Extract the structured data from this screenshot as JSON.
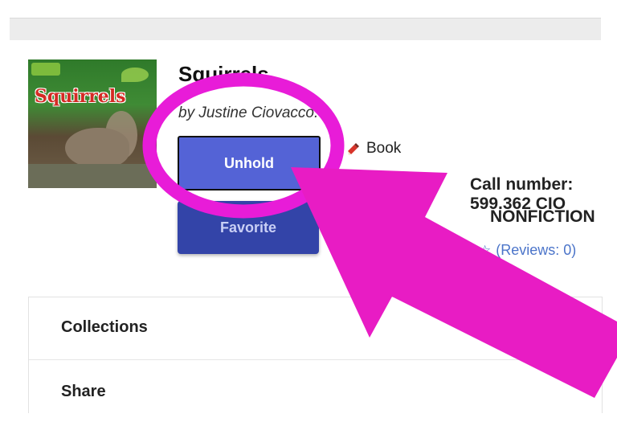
{
  "book": {
    "cover_title": "Squirrels",
    "title": "Squirrels",
    "author": "by Justine Ciovacco.",
    "format": "Book",
    "call_number_label": "Call number:",
    "call_number": "599.362 CIO",
    "genre": "NONFICTION",
    "reviews_label": "(Reviews: 0)"
  },
  "actions": {
    "unhold_label": "Unhold",
    "second_label": "Favorite"
  },
  "panel": {
    "collections_label": "Collections",
    "share_label": "Share"
  },
  "annotation": {
    "circle_color": "#e81cd8",
    "arrow_color": "#e81cc4"
  },
  "icons": {
    "format": "book-icon",
    "reviews": "star-icon"
  }
}
